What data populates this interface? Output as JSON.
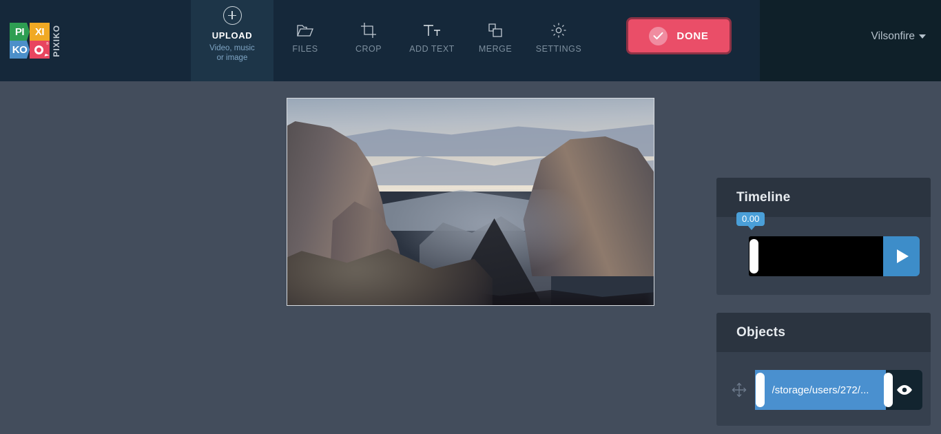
{
  "brand": {
    "logo_cells": [
      "PI",
      "XI",
      "KO",
      "O"
    ],
    "logo_vertical_text": "PIXIKO",
    "registered_mark": "®",
    "colors": {
      "green": "#2e9e52",
      "orange": "#f0a924",
      "blue": "#4c8fc9",
      "red": "#e8455f"
    }
  },
  "header": {
    "upload": {
      "icon": "plus-circle-icon",
      "title": "UPLOAD",
      "subtitle_line1": "Video, music",
      "subtitle_line2": "or image"
    },
    "tools": [
      {
        "label": "FILES",
        "icon": "folder-icon"
      },
      {
        "label": "CROP",
        "icon": "crop-icon"
      },
      {
        "label": "ADD TEXT",
        "icon": "text-tt-icon"
      },
      {
        "label": "MERGE",
        "icon": "merge-shapes-icon"
      },
      {
        "label": "SETTINGS",
        "icon": "gear-icon"
      }
    ],
    "done_button": {
      "label": "DONE",
      "icon": "check-circle-icon",
      "color": "#ea4e68",
      "border_color": "#8e3245"
    },
    "user": {
      "name": "Vilsonfire",
      "caret_icon": "chevron-down-icon"
    }
  },
  "stage": {
    "canvas": {
      "alt": "mountain rock formations at dusk"
    }
  },
  "timeline": {
    "title": "Timeline",
    "current_time": "0.00",
    "badge_color": "#4a9fd8",
    "play_button_icon": "play-icon",
    "play_button_color": "#3d8dc9",
    "track_color": "#000000",
    "playhead_icon": "playhead-handle"
  },
  "objects": {
    "title": "Objects",
    "items": [
      {
        "move_icon": "move-arrows-icon",
        "label": "/storage/users/272/...",
        "clip_color": "#4a90cf",
        "visibility_icon": "eye-icon"
      }
    ]
  }
}
